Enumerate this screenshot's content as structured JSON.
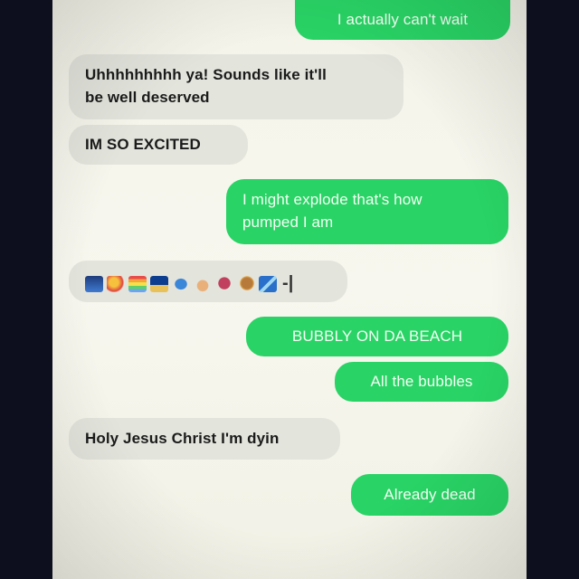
{
  "conversation": {
    "messages": [
      {
        "side": "sent",
        "text": "I actually can't wait"
      },
      {
        "side": "recv",
        "text_lines": [
          "Uhhhhhhhhh ya! Sounds like it'll",
          "be well deserved"
        ]
      },
      {
        "side": "recv",
        "text": "IM SO EXCITED"
      },
      {
        "side": "sent",
        "text_lines": [
          "I might explode that's how",
          "pumped I am"
        ]
      },
      {
        "side": "recv",
        "emoji": [
          "sunset-icon",
          "party-popper-icon",
          "rainbow-icon",
          "beach-icon",
          "fish-icon",
          "shell-icon",
          "octopus-icon",
          "snail-icon",
          "wave-icon"
        ],
        "trailing_text": "-|"
      },
      {
        "side": "sent",
        "text": "BUBBLY ON DA BEACH"
      },
      {
        "side": "sent",
        "text": "All the bubbles"
      },
      {
        "side": "recv",
        "text": "Holy Jesus Christ I'm dyin"
      },
      {
        "side": "sent",
        "text": "Already dead"
      }
    ]
  },
  "colors": {
    "sent_bubble": "#29d365",
    "received_bubble": "#e3e4dc",
    "screen_background": "#f4f4ea",
    "frame": "#0d0f1e"
  }
}
